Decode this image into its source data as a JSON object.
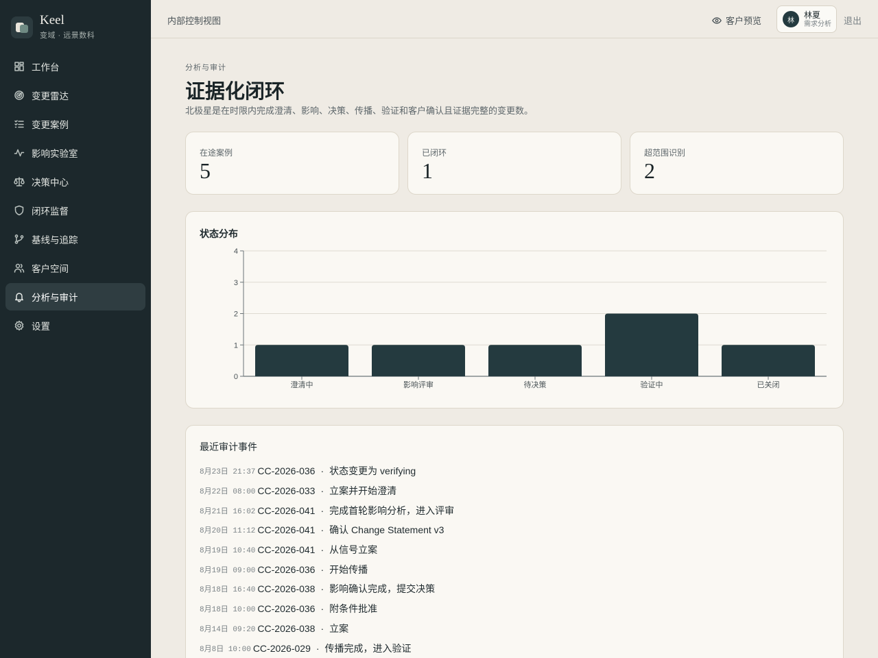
{
  "brand": {
    "name": "Keel",
    "subtitle": "变域 · 远景数科"
  },
  "sidebar": {
    "items": [
      {
        "label": "工作台",
        "icon": "dashboard-icon"
      },
      {
        "label": "变更雷达",
        "icon": "radar-icon"
      },
      {
        "label": "变更案例",
        "icon": "list-check-icon"
      },
      {
        "label": "影响实验室",
        "icon": "activity-icon"
      },
      {
        "label": "决策中心",
        "icon": "scale-icon"
      },
      {
        "label": "闭环监督",
        "icon": "shield-icon"
      },
      {
        "label": "基线与追踪",
        "icon": "branch-icon"
      },
      {
        "label": "客户空间",
        "icon": "users-icon"
      },
      {
        "label": "分析与审计",
        "icon": "bell-icon",
        "active": true
      },
      {
        "label": "设置",
        "icon": "gear-icon"
      }
    ]
  },
  "topbar": {
    "title": "内部控制视图",
    "preview_label": "客户预览",
    "user": {
      "initial": "林",
      "name": "林夏",
      "role": "需求分析"
    },
    "logout_label": "退出"
  },
  "page": {
    "eyebrow": "分析与审计",
    "title": "证据化闭环",
    "description": "北极星是在时限内完成澄清、影响、决策、传播、验证和客户确认且证据完整的变更数。"
  },
  "stats": [
    {
      "label": "在途案例",
      "value": "5"
    },
    {
      "label": "已闭环",
      "value": "1"
    },
    {
      "label": "超范围识别",
      "value": "2"
    }
  ],
  "chart_card": {
    "title": "状态分布"
  },
  "chart_data": {
    "type": "bar",
    "categories": [
      "澄清中",
      "影响评审",
      "待决策",
      "验证中",
      "已关闭"
    ],
    "values": [
      1,
      1,
      1,
      2,
      1
    ],
    "ylim": [
      0,
      4
    ],
    "yticks": [
      0,
      1,
      2,
      3,
      4
    ],
    "grid": true,
    "bar_color": "#243a3f"
  },
  "events_card": {
    "title": "最近审计事件"
  },
  "events": [
    {
      "time": "8月23日 21:37",
      "case": "CC-2026-036",
      "text": "状态变更为 verifying"
    },
    {
      "time": "8月22日 08:00",
      "case": "CC-2026-033",
      "text": "立案并开始澄清"
    },
    {
      "time": "8月21日 16:02",
      "case": "CC-2026-041",
      "text": "完成首轮影响分析，进入评审"
    },
    {
      "time": "8月20日 11:12",
      "case": "CC-2026-041",
      "text": "确认 Change Statement v3"
    },
    {
      "time": "8月19日 10:40",
      "case": "CC-2026-041",
      "text": "从信号立案"
    },
    {
      "time": "8月19日 09:00",
      "case": "CC-2026-036",
      "text": "开始传播"
    },
    {
      "time": "8月18日 16:40",
      "case": "CC-2026-038",
      "text": "影响确认完成，提交决策"
    },
    {
      "time": "8月18日 10:00",
      "case": "CC-2026-036",
      "text": "附条件批准"
    },
    {
      "time": "8月14日 09:20",
      "case": "CC-2026-038",
      "text": "立案"
    },
    {
      "time": "8月8日 10:00",
      "case": "CC-2026-029",
      "text": "传播完成，进入验证"
    }
  ],
  "separator": "·"
}
